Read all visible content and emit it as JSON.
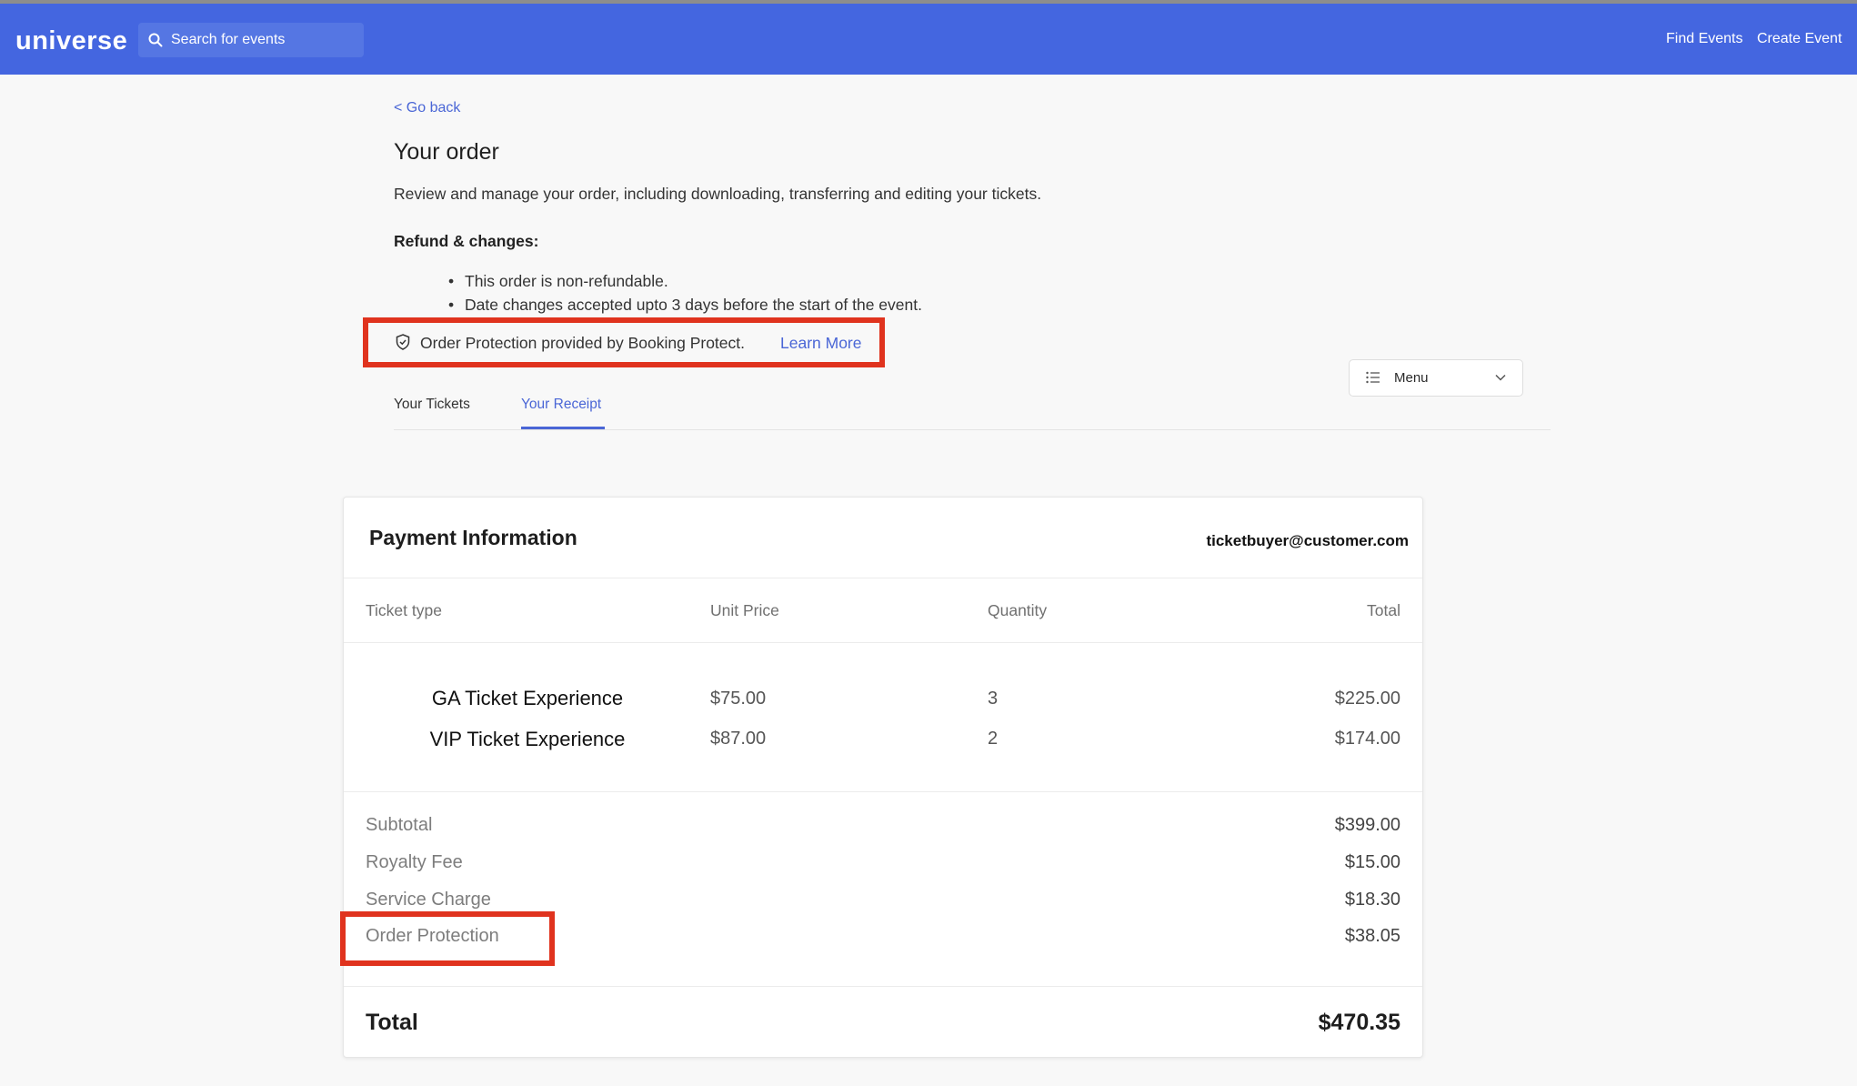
{
  "header": {
    "logo": "universe",
    "search_placeholder": "Search for events",
    "find_events": "Find Events",
    "create_event": "Create Event",
    "brand_color": "#4466e0"
  },
  "order": {
    "go_back": "< Go back",
    "title": "Your order",
    "intro": "Review and manage your order, including downloading, transferring and editing your tickets.",
    "refund_heading": "Refund & changes:",
    "policies": [
      "This order is non-refundable.",
      "Date changes accepted upto 3 days before the start of the event."
    ],
    "protection_text": "Order Protection provided by Booking Protect.",
    "learn_more": "Learn More",
    "menu_label": "Menu",
    "tabs": [
      "Your Tickets",
      "Your Receipt"
    ],
    "active_tab": "Your Receipt"
  },
  "payment": {
    "title": "Payment Information",
    "email": "ticketbuyer@customer.com",
    "columns": [
      "Ticket type",
      "Unit Price",
      "Quantity",
      "Total"
    ],
    "rows": [
      {
        "ticket_type": "GA Ticket Experience",
        "unit_price": "$75.00",
        "quantity": "3",
        "total": "$225.00"
      },
      {
        "ticket_type": "VIP Ticket Experience",
        "unit_price": "$87.00",
        "quantity": "2",
        "total": "$174.00"
      }
    ],
    "summary": [
      {
        "label": "Subtotal",
        "value": "$399.00"
      },
      {
        "label": "Royalty Fee",
        "value": "$15.00"
      },
      {
        "label": "Service Charge",
        "value": "$18.30"
      },
      {
        "label": "Order Protection",
        "value": "$38.05"
      }
    ],
    "total_label": "Total",
    "total_value": "$470.35",
    "highlight_color": "#e0331e"
  }
}
